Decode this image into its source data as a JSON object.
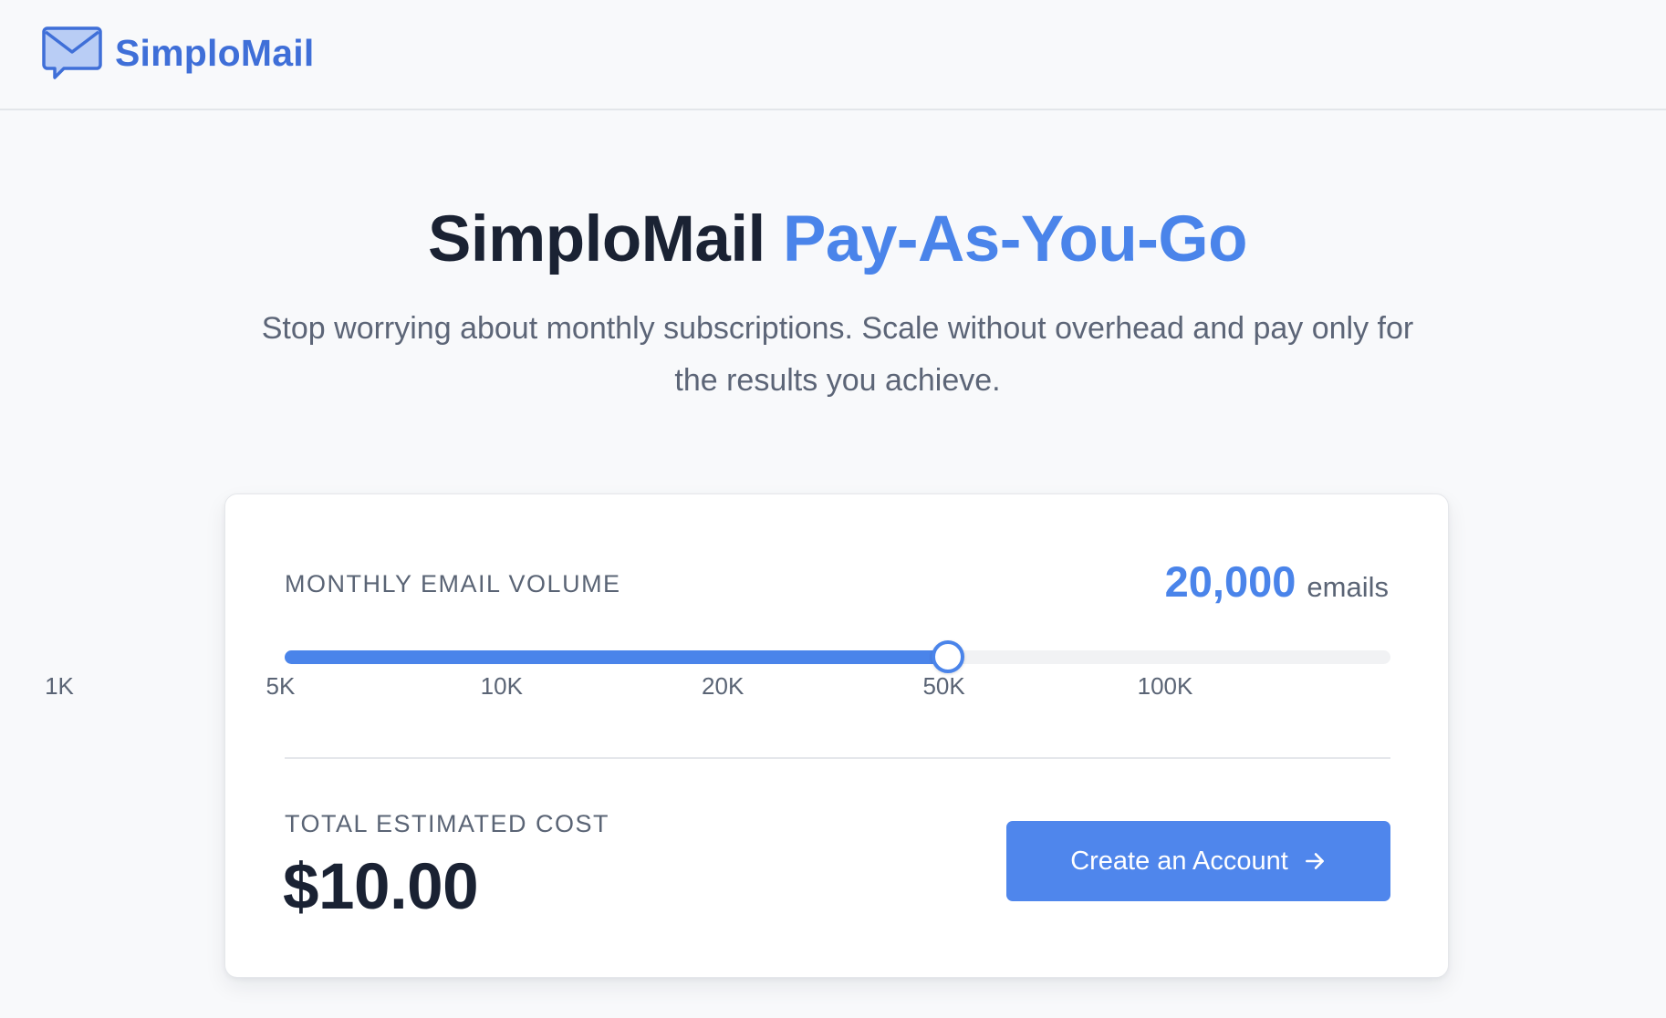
{
  "header": {
    "brand_name": "SimploMail",
    "brand_icon": "mail-chat-icon",
    "accent_color": "#3f6fd8"
  },
  "hero": {
    "title_primary": "SimploMail",
    "title_accent": "Pay-As-You-Go",
    "subtitle": "Stop worrying about monthly subscriptions. Scale without overhead and pay only for the results you achieve.",
    "accent_color": "#4a84ea"
  },
  "calculator": {
    "volume_label": "MONTHLY EMAIL VOLUME",
    "volume_value": "20,000",
    "volume_unit": "emails",
    "slider": {
      "ticks": [
        "1K",
        "5K",
        "10K",
        "20K",
        "50K",
        "100K"
      ],
      "selected_index": 3,
      "selected_label": "20K",
      "level_fraction": 0.6
    },
    "cost_label": "TOTAL ESTIMATED COST",
    "cost_value": "$10.00",
    "cta_label": "Create an Account",
    "cta_icon": "arrow-right-icon",
    "cta_color": "#4f86ec"
  }
}
